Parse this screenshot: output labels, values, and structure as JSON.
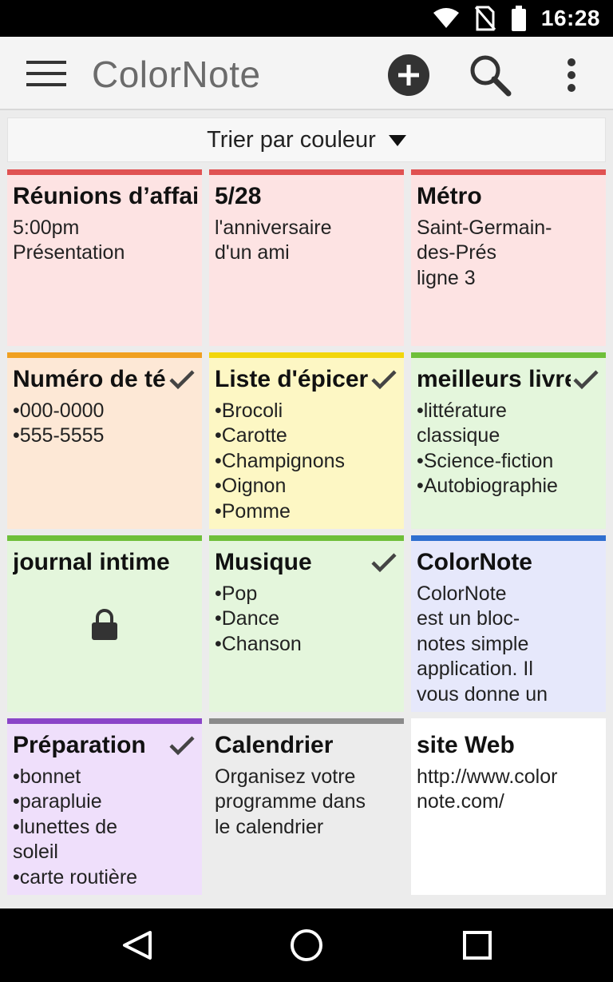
{
  "status_bar": {
    "time": "16:28",
    "icons": [
      "wifi-icon",
      "no-sim-icon",
      "battery-icon"
    ]
  },
  "app_bar": {
    "title": "ColorNote",
    "icons": [
      "hamburger-menu-icon",
      "add-circle-icon",
      "search-icon",
      "more-vert-icon"
    ]
  },
  "sort": {
    "label": "Trier par couleur"
  },
  "colors": {
    "red_bar": "#e05252",
    "red_bg": "#fde3e3",
    "orange_bar": "#f0a021",
    "orange_bg": "#fde8d6",
    "yellow_bar": "#f2d60c",
    "yellow_bg": "#fdf7c4",
    "green_bar": "#6fbf3a",
    "green_bg": "#e4f6dc",
    "blue_bar": "#2f6fcf",
    "blue_bg": "#e6e8fb",
    "purple_bar": "#8a44c8",
    "purple_bg": "#efdffb",
    "gray_bar": "#8a8a8a",
    "gray_bg": "#ececec",
    "white_bg": "#ffffff"
  },
  "notes": [
    {
      "title": "Réunions d’affaires",
      "body": "5:00pm\nPrésentation",
      "color": "red",
      "checked": false,
      "locked": false
    },
    {
      "title": "5/28",
      "body": "l'anniversaire\nd'un ami",
      "color": "red",
      "checked": false,
      "locked": false
    },
    {
      "title": "Métro",
      "body": "Saint-Germain-\ndes-Prés\nligne 3",
      "color": "red",
      "checked": false,
      "locked": false
    },
    {
      "title": "Numéro de téléphone",
      "body": "•000-0000\n•555-5555",
      "color": "orange",
      "checked": true,
      "locked": false
    },
    {
      "title": "Liste d'épicerie",
      "body": "•Brocoli\n•Carotte\n•Champignons\n•Oignon\n•Pomme",
      "color": "yellow",
      "checked": true,
      "locked": false
    },
    {
      "title": "meilleurs livres",
      "body": "•littérature\nclassique\n•Science-fiction\n•Autobiographie",
      "color": "green",
      "checked": true,
      "locked": false
    },
    {
      "title": "journal intime",
      "body": "",
      "color": "green",
      "checked": false,
      "locked": true
    },
    {
      "title": "Musique",
      "body": "•Pop\n•Dance\n•Chanson",
      "color": "green",
      "checked": true,
      "locked": false
    },
    {
      "title": "ColorNote",
      "body": "ColorNote\nest un bloc-\nnotes simple\napplication. Il\nvous donne un",
      "color": "blue",
      "checked": false,
      "locked": false
    },
    {
      "title": "Préparation",
      "body": "•bonnet\n•parapluie\n•lunettes de\nsoleil\n•carte routière",
      "color": "purple",
      "checked": true,
      "locked": false
    },
    {
      "title": "Calendrier",
      "body": "Organisez votre\nprogramme dans\nle calendrier",
      "color": "gray",
      "checked": false,
      "locked": false
    },
    {
      "title": "site Web",
      "body": "http://www.color\nnote.com/",
      "color": "white",
      "checked": false,
      "locked": false
    }
  ],
  "nav_bar": {
    "icons": [
      "back-icon",
      "home-icon",
      "recent-apps-icon"
    ]
  }
}
